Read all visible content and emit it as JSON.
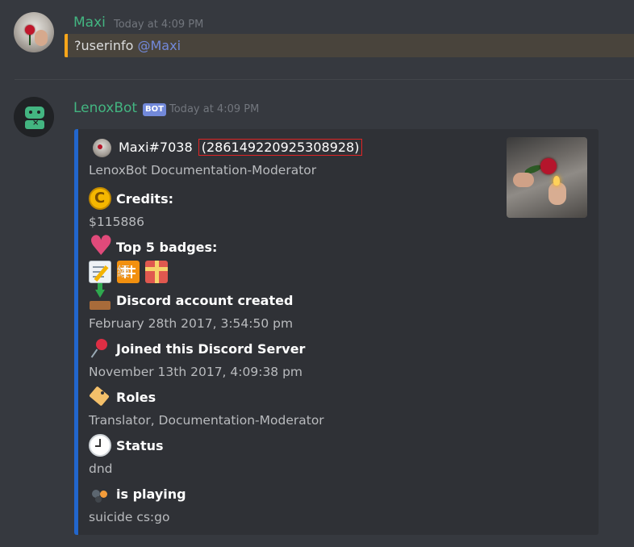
{
  "messages": [
    {
      "author": "Maxi",
      "author_color": "#43b581",
      "timestamp": "Today at 4:09 PM",
      "content_prefix": "?userinfo ",
      "mention": "@Maxi"
    },
    {
      "author": "LenoxBot",
      "author_color": "#43b581",
      "bot_tag": "BOT",
      "timestamp": "Today at 4:09 PM",
      "embed": {
        "border_color": "#2266cc",
        "author_name": "Maxi#7038",
        "author_id": "(286149220925308928)",
        "subtitle": "LenoxBot Documentation-Moderator",
        "fields": [
          {
            "icon": "credits-icon",
            "name": "Credits:",
            "value": "$115886"
          },
          {
            "icon": "heart-icon",
            "name": "Top 5 badges:"
          },
          {
            "icon": "inbox-tray-icon",
            "name": "Discord account created",
            "value": "February 28th 2017, 3:54:50 pm"
          },
          {
            "icon": "pushpin-icon",
            "name": "Joined this Discord Server",
            "value": "November 13th 2017, 4:09:38 pm"
          },
          {
            "icon": "label-tag-icon",
            "name": "Roles",
            "value": "Translator, Documentation-Moderator"
          },
          {
            "icon": "clock-icon",
            "name": "Status",
            "value": "dnd"
          },
          {
            "icon": "game-dots-icon",
            "name": "is playing",
            "value": "suicide cs:go"
          }
        ],
        "badges": [
          "memo-icon",
          "grid-badge-icon",
          "gift-icon"
        ]
      }
    }
  ]
}
